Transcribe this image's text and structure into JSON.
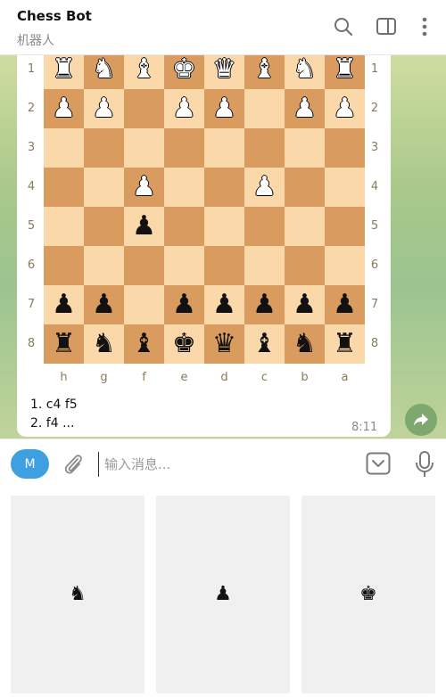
{
  "header": {
    "title": "Chess Bot",
    "subtitle": "机器人",
    "icons": [
      "search-icon",
      "sidebar-toggle-icon",
      "more-vert-icon"
    ]
  },
  "board": {
    "rank_labels": [
      "1",
      "2",
      "3",
      "4",
      "5",
      "6",
      "7",
      "8"
    ],
    "file_labels": [
      "h",
      "g",
      "f",
      "e",
      "d",
      "c",
      "b",
      "a"
    ],
    "rows": [
      [
        "wR",
        "wN",
        "wB",
        "wK",
        "wQ",
        "wB",
        "wN",
        "wR"
      ],
      [
        "wP",
        "wP",
        "",
        "wP",
        "wP",
        "",
        "wP",
        "wP"
      ],
      [
        "",
        "",
        "",
        "",
        "",
        "",
        "",
        ""
      ],
      [
        "",
        "",
        "wP",
        "",
        "",
        "wP",
        "",
        ""
      ],
      [
        "",
        "",
        "bP",
        "",
        "",
        "",
        "",
        ""
      ],
      [
        "",
        "",
        "",
        "",
        "",
        "",
        "",
        ""
      ],
      [
        "bP",
        "bP",
        "",
        "bP",
        "bP",
        "bP",
        "bP",
        "bP"
      ],
      [
        "bR",
        "bN",
        "bB",
        "bK",
        "bQ",
        "bB",
        "bN",
        "bR"
      ]
    ]
  },
  "message": {
    "moves": [
      "1. c4 f5",
      "2. f4 ..."
    ],
    "time": "8:11"
  },
  "input": {
    "avatar_letter": "M",
    "placeholder": "输入消息..."
  },
  "keyboard": {
    "buttons": [
      {
        "piece": "bN",
        "icon": "black-knight-icon"
      },
      {
        "piece": "bP",
        "icon": "black-pawn-icon"
      },
      {
        "piece": "bK",
        "icon": "black-king-icon"
      }
    ]
  },
  "colors": {
    "light_square": "#fbd8a9",
    "dark_square": "#d99b5e",
    "accent": "#3ea0e0",
    "share_button": "#7ea870"
  }
}
